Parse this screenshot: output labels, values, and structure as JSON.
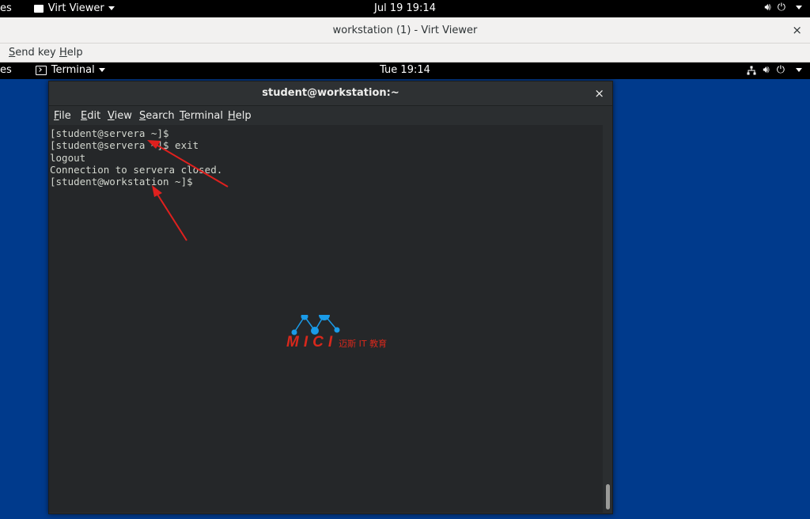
{
  "host_bar": {
    "activities": "es",
    "app_name": "Virt Viewer",
    "clock": "Jul 19  19:14"
  },
  "viewer": {
    "title": "workstation (1) - Virt Viewer",
    "close": "×",
    "menu": [
      {
        "label": "Send key",
        "u": "S",
        "rest": "end key"
      },
      {
        "label": "Help",
        "u": "H",
        "rest": "elp"
      }
    ]
  },
  "guest_bar": {
    "activities": "es",
    "app_name": "Terminal",
    "clock": "Tue 19:14"
  },
  "terminal": {
    "title": "student@workstation:~",
    "close": "×",
    "menu": [
      {
        "u": "F",
        "rest": "ile"
      },
      {
        "u": "E",
        "rest": "dit"
      },
      {
        "u": "V",
        "rest": "iew"
      },
      {
        "u": "S",
        "rest": "earch"
      },
      {
        "u": "T",
        "rest": "erminal"
      },
      {
        "u": "H",
        "rest": "elp"
      }
    ],
    "lines": [
      "[student@servera ~]$",
      "[student@servera ~]$ exit",
      "logout",
      "Connection to servera closed.",
      "[student@workstation ~]$"
    ]
  },
  "watermark": {
    "brand": "MICI",
    "tagline": "迈斯 IT 教育"
  },
  "colors": {
    "desktop": "#003a8c",
    "annotation": "#e0201e",
    "watermark_blue": "#1a9be8",
    "watermark_red": "#d8281c"
  }
}
